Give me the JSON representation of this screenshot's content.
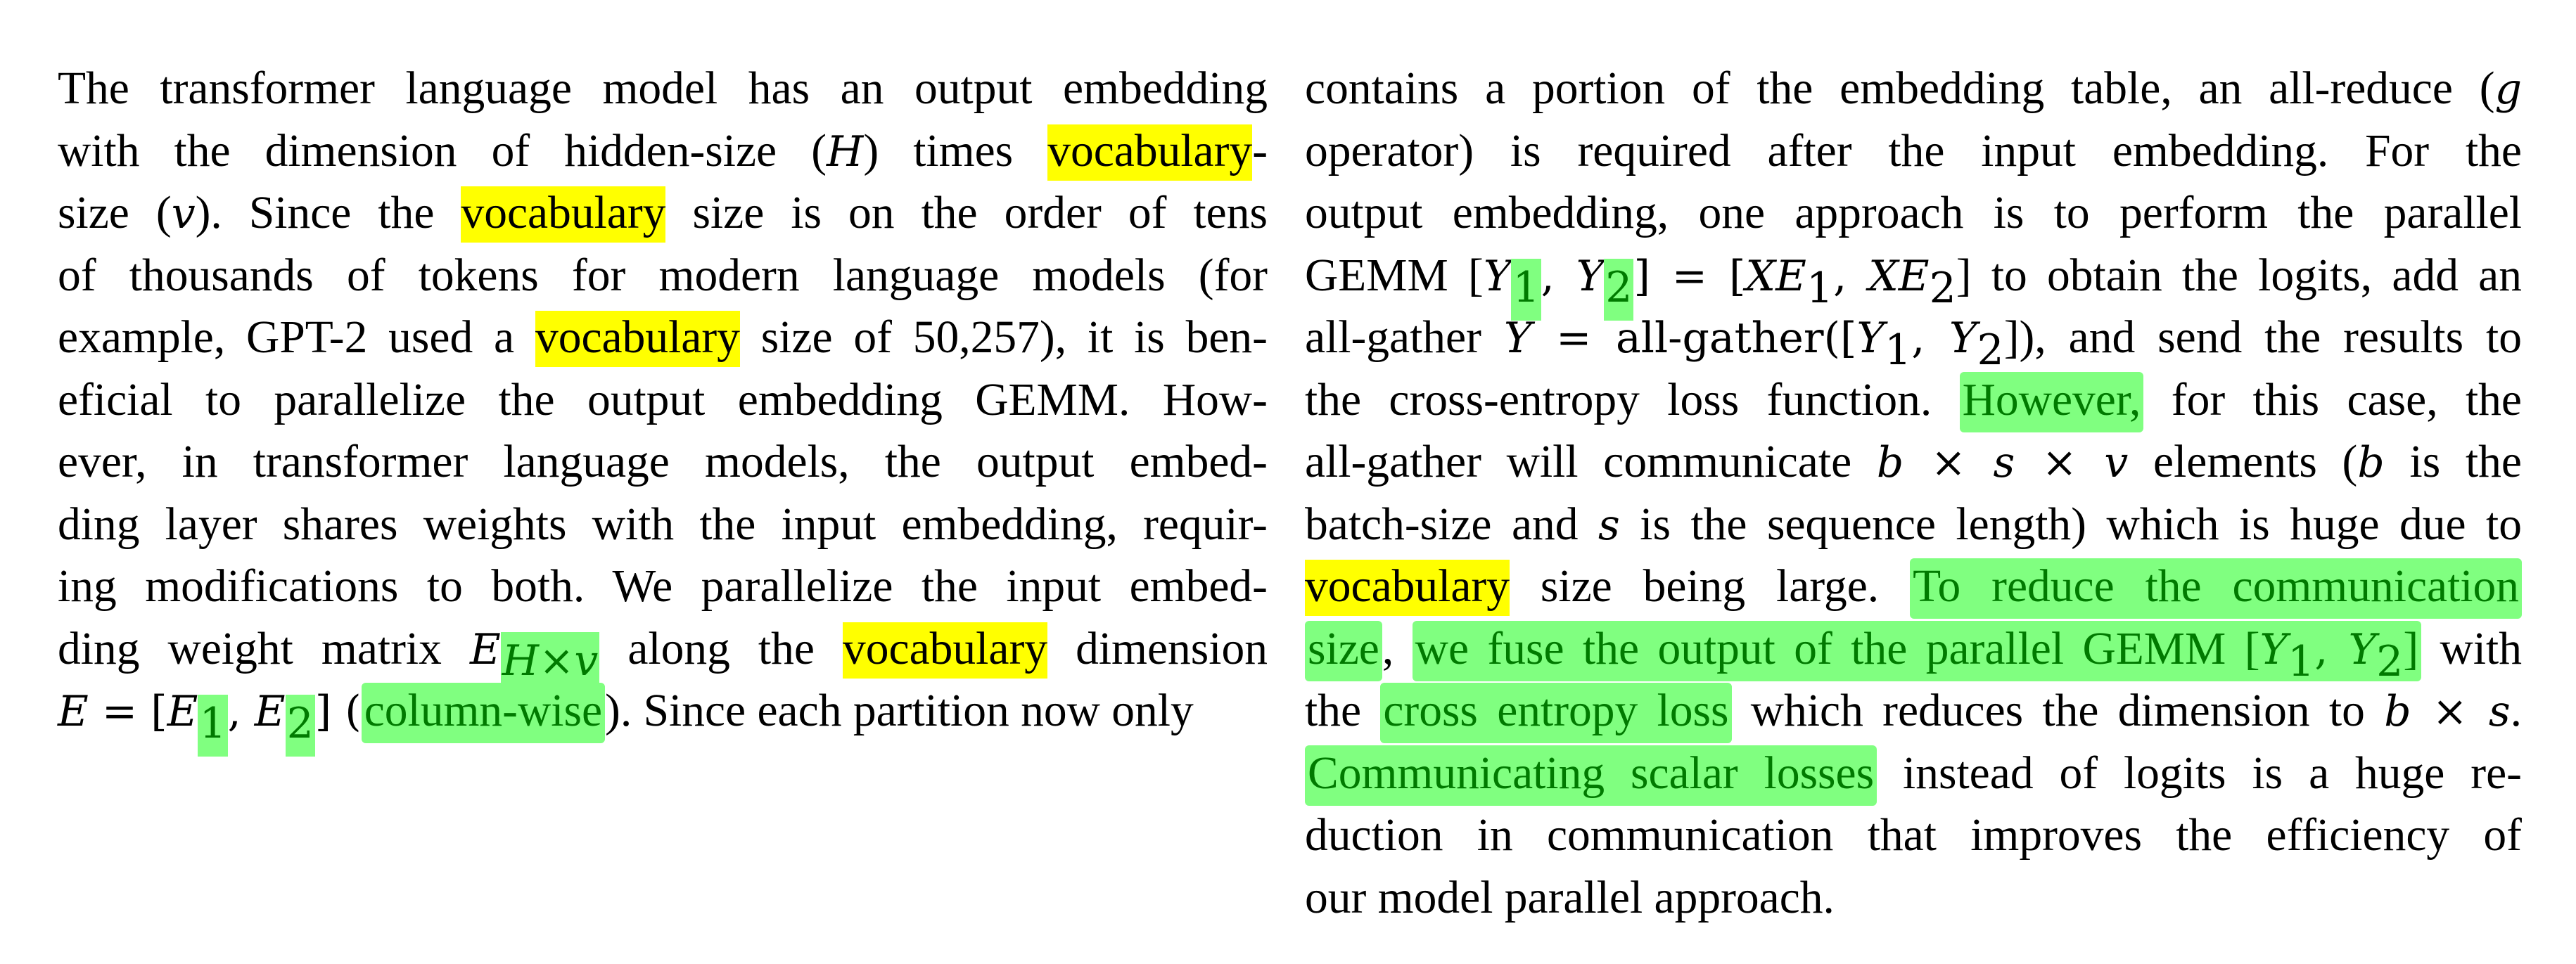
{
  "colors": {
    "highlight_yellow": "#ffff00",
    "highlight_green": "#80ff80",
    "highlighted_text_green": "#007a00",
    "text": "#000000",
    "background": "#ffffff"
  },
  "left_column": {
    "l1": "The transformer language model has an output embedding",
    "l2a": "with the dimension of hidden-size (",
    "l2_H": "H",
    "l2b": ") times ",
    "l2_hl": "vocabulary",
    "l2c": "-",
    "l3a": "size (",
    "l3_v": "v",
    "l3b": ").  Since the ",
    "l3_hl": "vocabulary",
    "l3c": " size is on the order of tens",
    "l4": "of thousands of tokens for modern language models (for",
    "l5a": "example, GPT-2 used a ",
    "l5_hl": "vocabulary",
    "l5b": " size of 50,257), it is ben-",
    "l6": "eficial to parallelize the output embedding GEMM. How-",
    "l7": "ever, in transformer language models, the output embed-",
    "l8": "ding layer shares weights with the input embedding, requir-",
    "l9": "ing modifications to both. We parallelize the input embed-",
    "l10a": "ding weight matrix ",
    "l10_E": "E",
    "l10_sub": "H×v",
    "l10b": " along the ",
    "l10_hl": "vocabulary",
    "l10c": " dimension",
    "l11_E": "E",
    "l11_eq": " = [",
    "l11_E1": "E",
    "l11_sub1": "1",
    "l11_comma": ", ",
    "l11_E2": "E",
    "l11_sub2": "2",
    "l11_close": "] (",
    "l11_hl": "column-wise",
    "l11b": "). Since each partition now only"
  },
  "right_column": {
    "l1a": "contains a portion of the embedding table, an all-reduce (",
    "l1_g": "g",
    "l2": "operator) is required after the input embedding.  For the",
    "l3": "output embedding, one approach is to perform the parallel",
    "l4a": "GEMM [",
    "l4_Y": "Y",
    "l4_s1": "1",
    "l4_c": ", ",
    "l4_Y2": "Y",
    "l4_s2": "2",
    "l4b": "] = [",
    "l4_XE1": "XE",
    "l4_s3": "1",
    "l4_c2": ", ",
    "l4_XE2": "XE",
    "l4_s4": "2",
    "l4c": "] to obtain the logits, add an",
    "l5a": "all-gather ",
    "l5_Y": "Y",
    "l5b": " = all-gather([",
    "l5_Y1": "Y",
    "l5_s1": "1",
    "l5_c": ", ",
    "l5_Y2": "Y",
    "l5_s2": "2",
    "l5c": "]), and send the results to",
    "l6a": "the cross-entropy loss function. ",
    "l6_hl": "However,",
    "l6b": " for this case, the",
    "l7a": "all-gather will communicate ",
    "l7_math": "b × s × v",
    "l7b": " elements (",
    "l7_b": "b",
    "l7c": " is the",
    "l8a": "batch-size and ",
    "l8_s": "s",
    "l8b": " is the sequence length) which is huge due to",
    "l9_hl_y": "vocabulary",
    "l9a": " size being large. ",
    "l9_hl_g": "To reduce the communication",
    "l10_hl1": "size",
    "l10a": ", ",
    "l10_hl2a": "we fuse the output of the parallel GEMM [",
    "l10_Y1": "Y",
    "l10_s1": "1",
    "l10_c": ", ",
    "l10_Y2": "Y",
    "l10_s2": "2",
    "l10_hl2b": "]",
    "l10b": " with",
    "l11a": "the ",
    "l11_hl": "cross entropy loss",
    "l11b": " which reduces the dimension to ",
    "l11_math": "b × s",
    "l11c": ".",
    "l12_hl": "Communicating scalar losses",
    "l12b": " instead of logits is a huge re-",
    "l13": "duction in communication that improves the efficiency of",
    "l14": "our model parallel approach."
  }
}
